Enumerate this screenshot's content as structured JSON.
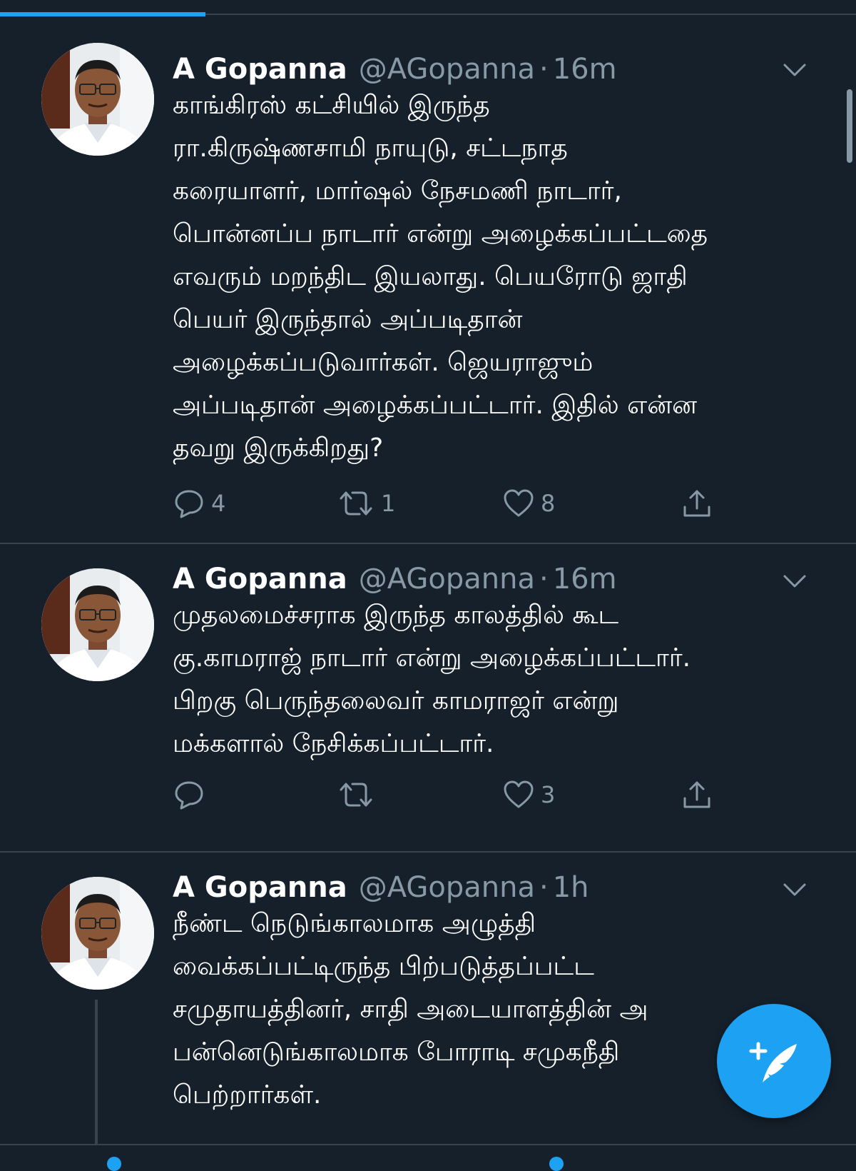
{
  "progress": {
    "fraction": 0.24
  },
  "tweets": [
    {
      "name": "A Gopanna",
      "handle": "@AGopanna",
      "time": "16m",
      "text": "காங்கிரஸ் கட்சியில் இருந்த\nரா.கிருஷ்ணசாமி நாயுடு, சட்டநாத\nகரையாளர், மார்ஷல்  நேசமணி நாடார்,\nபொன்னப்ப நாடார் என்று அழைக்கப்பட்டதை\nஎவரும் மறந்திட இயலாது. பெயரோடு ஜாதி\nபெயர் இருந்தால் அப்படிதான்\nஅழைக்கப்படுவார்கள். ஜெயராஜும்\nஅப்படிதான் அழைக்கப்பட்டார். இதில் என்ன\nதவறு இருக்கிறது?",
      "replies": "4",
      "retweets": "1",
      "likes": "8"
    },
    {
      "name": "A Gopanna",
      "handle": "@AGopanna",
      "time": "16m",
      "text": "முதலமைச்சராக இருந்த காலத்தில் கூட\nகு.காமராஜ் நாடார் என்று அழைக்கப்பட்டார்.\nபிறகு பெருந்தலைவர் காமராஜர் என்று\nமக்களால் நேசிக்கப்பட்டார்.",
      "replies": "",
      "retweets": "",
      "likes": "3"
    },
    {
      "name": "A Gopanna",
      "handle": "@AGopanna",
      "time": "1h",
      "text": "நீண்ட நெடுங்காலமாக அழுத்தி\nவைக்கப்பட்டிருந்த பிற்படுத்தப்பட்ட\nசமுதாயத்தினர்,  சாதி அடையாளத்தின் அ\nபன்னெடுங்காலமாக போராடி சமுகநீதி\nபெற்றார்கள்."
    }
  ],
  "colors": {
    "background": "#15202b",
    "accent": "#1da1f2",
    "secondary_text": "#8899a6",
    "divider": "#38444d"
  },
  "icons": {
    "reply": "reply-icon",
    "retweet": "retweet-icon",
    "like": "heart-icon",
    "share": "share-icon",
    "caret": "chevron-down-icon",
    "compose": "compose-tweet-icon"
  }
}
